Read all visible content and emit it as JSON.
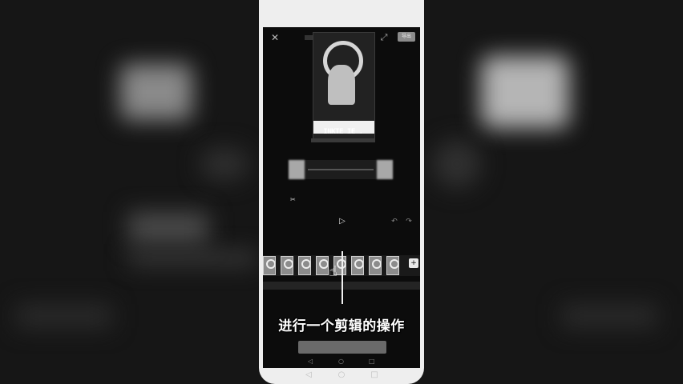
{
  "header": {
    "close_icon": "✕",
    "fullscreen_icon": "⤢",
    "export_label": "导出"
  },
  "preview": {
    "title_text": "INKTE IE ."
  },
  "editor": {
    "play_icon": "▷",
    "undo_icon": "↶",
    "redo_icon": "↷",
    "add_clip_icon": "+"
  },
  "subtitle": "进行一个剪辑的操作",
  "nav": {
    "back_icon": "◁",
    "home_icon": "○",
    "recent_icon": "□"
  }
}
